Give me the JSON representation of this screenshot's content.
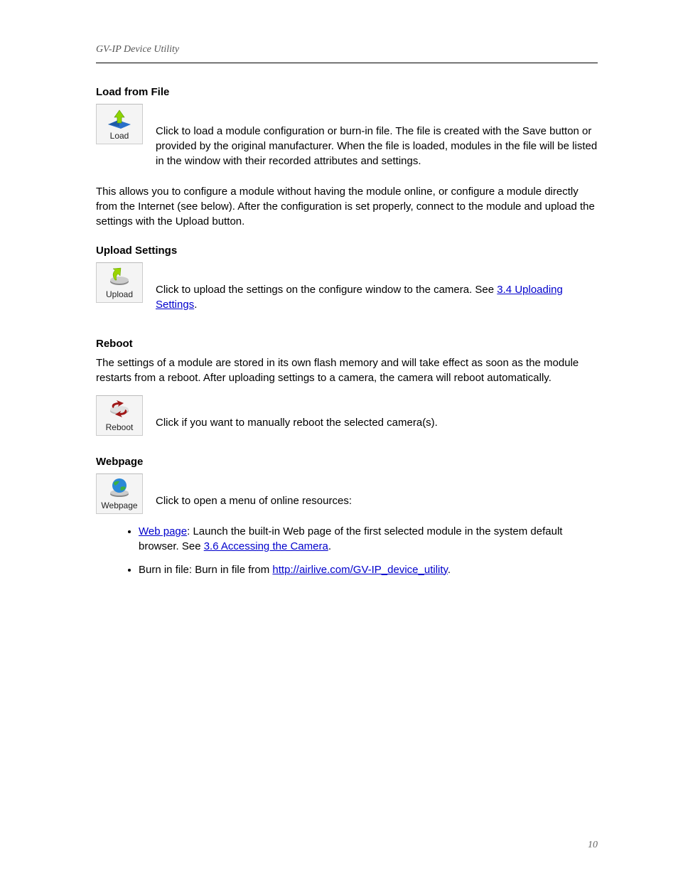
{
  "header": {
    "left": "GV-IP Device Utility",
    "right": ""
  },
  "sections": {
    "load": {
      "heading": "Load from File",
      "icon_label": "Load",
      "lead": "Click ",
      "after": " to load a module configuration or burn-in file. The file is created with the Save button or provided by the original manufacturer. When the file is loaded, modules in the file will be listed in the window with their recorded attributes and settings.",
      "para2": "This allows you to configure a module without having the module online, or configure a module directly from the Internet (see below). After the configuration is set properly, connect to the module and upload the settings with the Upload button."
    },
    "upload": {
      "heading": "Upload Settings",
      "icon_label": "Upload",
      "lead": "Click ",
      "after": " to upload the settings on the configure window to the camera. See ",
      "link": "3.4 Uploading Settings",
      "period": "."
    },
    "reboot": {
      "heading": "Reboot",
      "icon_label": "Reboot",
      "para1": "The settings of a module are stored in its own flash memory and will take effect as soon as the module restarts from a reboot. After uploading settings to a camera, the camera will reboot automatically.",
      "lead": "Click ",
      "after": " if you want to manually reboot the selected camera(s)."
    },
    "webpage": {
      "heading": "Webpage",
      "icon_label": "Webpage",
      "lead": "Click ",
      "after": " to open a menu of online resources:",
      "bullets": [
        {
          "link_text": "Web page",
          "text_after": ": Launch the built-in Web page of the first selected module in the system default browser. See ",
          "link2": "3.6 Accessing the Camera",
          "period": "."
        },
        {
          "text_before": "Burn in file: Burn in file from ",
          "link_text": "http://airlive.com/GV-IP_device_utility",
          "period": "."
        }
      ]
    }
  },
  "footer": {
    "left": "",
    "right": "10"
  }
}
